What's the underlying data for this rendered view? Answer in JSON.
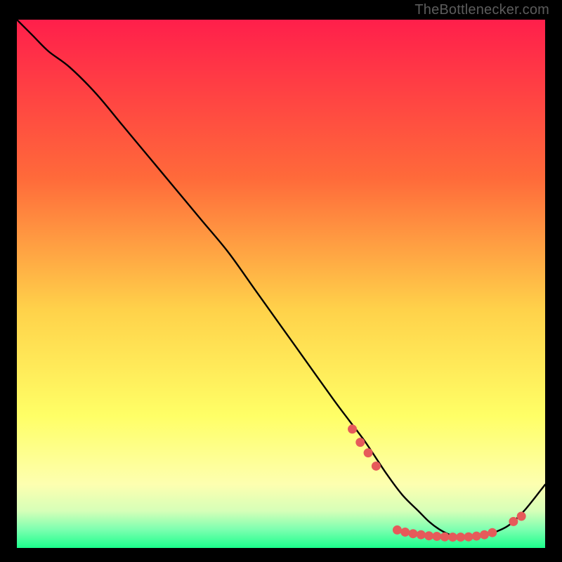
{
  "attribution": "TheBottlenecker.com",
  "chart_data": {
    "type": "line",
    "title": "",
    "xlabel": "",
    "ylabel": "",
    "xlim": [
      0,
      100
    ],
    "ylim": [
      0,
      100
    ],
    "gradient_stops": [
      {
        "offset": 0,
        "color": "#ff1f4b"
      },
      {
        "offset": 0.3,
        "color": "#ff6a3a"
      },
      {
        "offset": 0.55,
        "color": "#ffd24a"
      },
      {
        "offset": 0.75,
        "color": "#ffff66"
      },
      {
        "offset": 0.88,
        "color": "#fdffb0"
      },
      {
        "offset": 0.93,
        "color": "#d6ffb8"
      },
      {
        "offset": 0.965,
        "color": "#7dffb0"
      },
      {
        "offset": 1.0,
        "color": "#1bff8c"
      }
    ],
    "series": [
      {
        "name": "bottleneck-curve",
        "x": [
          0,
          3,
          6,
          10,
          15,
          20,
          25,
          30,
          35,
          40,
          45,
          50,
          55,
          60,
          63,
          66,
          70,
          73,
          76,
          78,
          80,
          82,
          84,
          86,
          88,
          90,
          93,
          96,
          100
        ],
        "y": [
          100,
          97,
          94,
          91,
          86,
          80,
          74,
          68,
          62,
          56,
          49,
          42,
          35,
          28,
          24,
          20,
          14,
          10,
          7,
          5,
          3.5,
          2.5,
          2,
          2,
          2.2,
          2.8,
          4.2,
          7,
          12
        ]
      }
    ],
    "markers": {
      "name": "highlight-dots",
      "color": "#e65a5a",
      "points": [
        {
          "x": 63.5,
          "y": 22.5
        },
        {
          "x": 65,
          "y": 20
        },
        {
          "x": 66.5,
          "y": 18
        },
        {
          "x": 68,
          "y": 15.5
        },
        {
          "x": 72,
          "y": 3.4
        },
        {
          "x": 73.5,
          "y": 3
        },
        {
          "x": 75,
          "y": 2.7
        },
        {
          "x": 76.5,
          "y": 2.5
        },
        {
          "x": 78,
          "y": 2.3
        },
        {
          "x": 79.5,
          "y": 2.2
        },
        {
          "x": 81,
          "y": 2.1
        },
        {
          "x": 82.5,
          "y": 2.05
        },
        {
          "x": 84,
          "y": 2.05
        },
        {
          "x": 85.5,
          "y": 2.1
        },
        {
          "x": 87,
          "y": 2.25
        },
        {
          "x": 88.5,
          "y": 2.5
        },
        {
          "x": 90,
          "y": 2.9
        },
        {
          "x": 94,
          "y": 5
        },
        {
          "x": 95.5,
          "y": 6
        }
      ]
    }
  }
}
